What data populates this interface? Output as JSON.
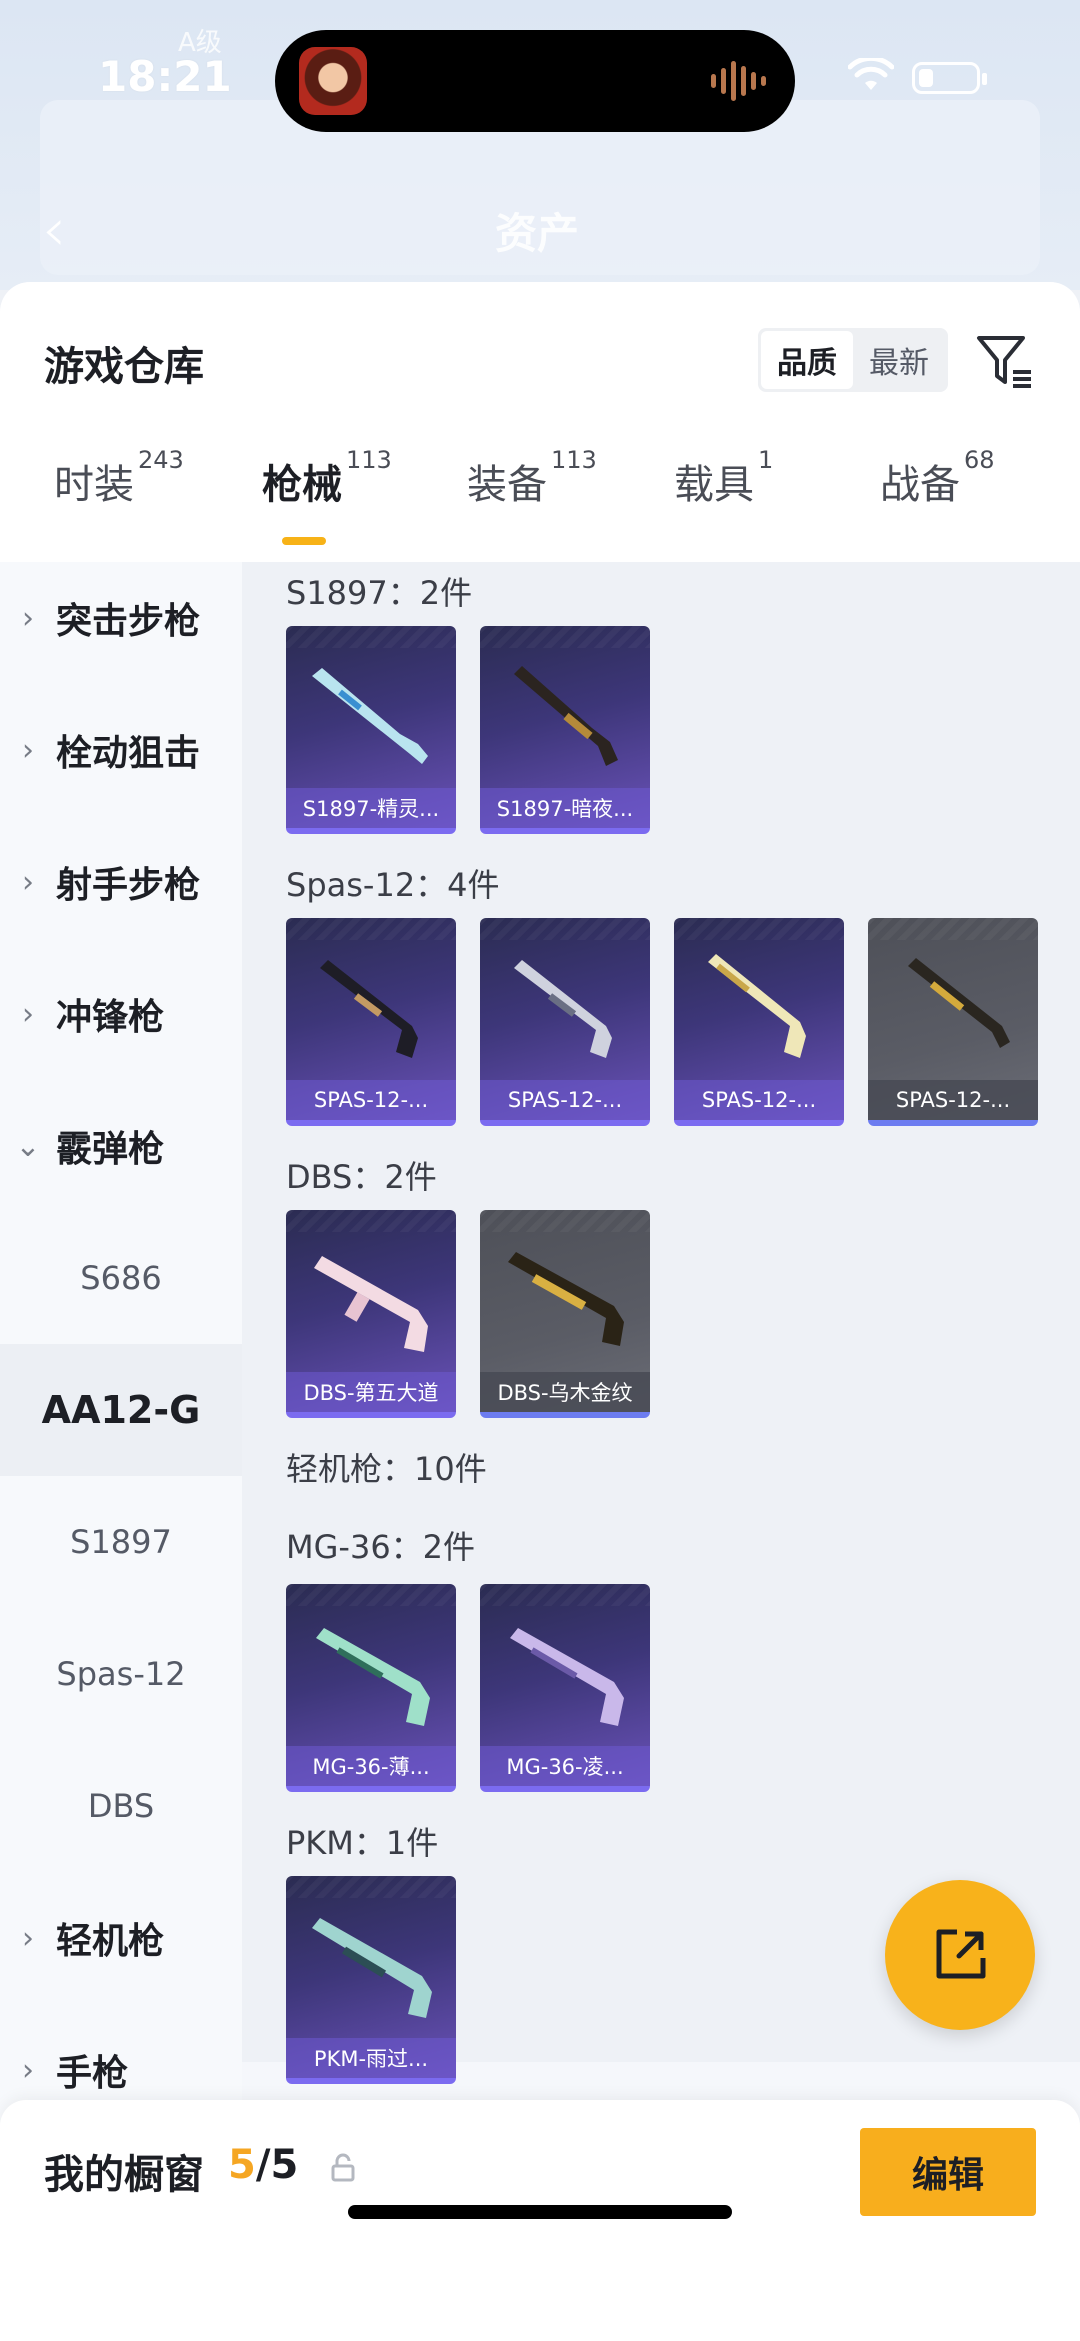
{
  "status": {
    "time": "18:21",
    "carrier": "A级"
  },
  "background": {
    "back_glyph": "‹",
    "title": "资产"
  },
  "sheet": {
    "title": "游戏仓库",
    "sort": {
      "quality": "品质",
      "latest": "最新"
    },
    "tabs": [
      {
        "label": "时装",
        "count": "243"
      },
      {
        "label": "枪械",
        "count": "113"
      },
      {
        "label": "装备",
        "count": "113"
      },
      {
        "label": "载具",
        "count": "1"
      },
      {
        "label": "战备",
        "count": "68"
      }
    ]
  },
  "leftnav": {
    "assault": "突击步枪",
    "bolt": "栓动狙击",
    "marksman": "射手步枪",
    "smg": "冲锋枪",
    "shotgun": "霰弹枪",
    "s686": "S686",
    "aa12": "AA12-G",
    "s1897": "S1897",
    "spas": "Spas-12",
    "dbs": "DBS",
    "lmg": "轻机枪",
    "pistol": "手枪"
  },
  "groups": {
    "s1897": "S1897：2件",
    "spas": "Spas-12：4件",
    "dbs": "DBS：2件",
    "lmg": "轻机枪：10件",
    "mg36": "MG-36：2件",
    "pkm": "PKM：1件"
  },
  "items": {
    "s1897_1": "S1897-精灵...",
    "s1897_2": "S1897-暗夜...",
    "spas_1": "SPAS-12-...",
    "spas_2": "SPAS-12-...",
    "spas_3": "SPAS-12-...",
    "spas_4": "SPAS-12-...",
    "dbs_1": "DBS-第五大道",
    "dbs_2": "DBS-乌木金纹",
    "mg36_1": "MG-36-薄...",
    "mg36_2": "MG-36-凌...",
    "pkm_1": "PKM-雨过..."
  },
  "bottom": {
    "label": "我的橱窗",
    "current": "5",
    "total": "/5",
    "edit": "编辑"
  },
  "colors": {
    "accent": "#f8b21b",
    "card_purple": "#3d3679",
    "card_gray": "#5a5c65"
  },
  "icons": [
    "filter-icon",
    "lock-icon",
    "share-icon",
    "chevron-right-icon",
    "chevron-down-icon"
  ]
}
